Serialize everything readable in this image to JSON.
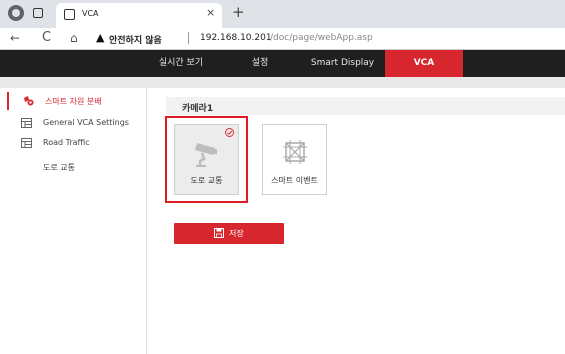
{
  "browser": {
    "tab_title": "VCA",
    "tab_close": "×",
    "new_tab": "+",
    "back": "←",
    "reload": "C",
    "home": "⌂",
    "security_icon": "▲",
    "security_warning": "안전하지 않음",
    "url_host": "192.168.10.201",
    "url_path": "/doc/page/webApp.asp"
  },
  "nav": {
    "tabs": [
      {
        "label": "실시간 보기"
      },
      {
        "label": "설정"
      },
      {
        "label": "Smart Display"
      },
      {
        "label": "VCA"
      }
    ],
    "active_index": 3
  },
  "sidebar": {
    "items": [
      {
        "label": "스마트 자원 분배",
        "icon": "smart-resource-icon"
      },
      {
        "label": "General VCA Settings",
        "icon": "grid-icon"
      },
      {
        "label": "Road Traffic",
        "icon": "grid-icon"
      },
      {
        "label": "도로 교통",
        "icon": ""
      }
    ]
  },
  "main": {
    "camera_title": "카메라1",
    "tiles": [
      {
        "label": "도로 교통",
        "icon": "traffic-camera-icon",
        "selected": true
      },
      {
        "label": "스마트 이벤트",
        "icon": "smart-event-icon",
        "selected": false
      }
    ],
    "save_label": "저장"
  },
  "colors": {
    "accent": "#d7262e",
    "nav_bg": "#1f1f1f",
    "highlight": "#e01b24"
  }
}
